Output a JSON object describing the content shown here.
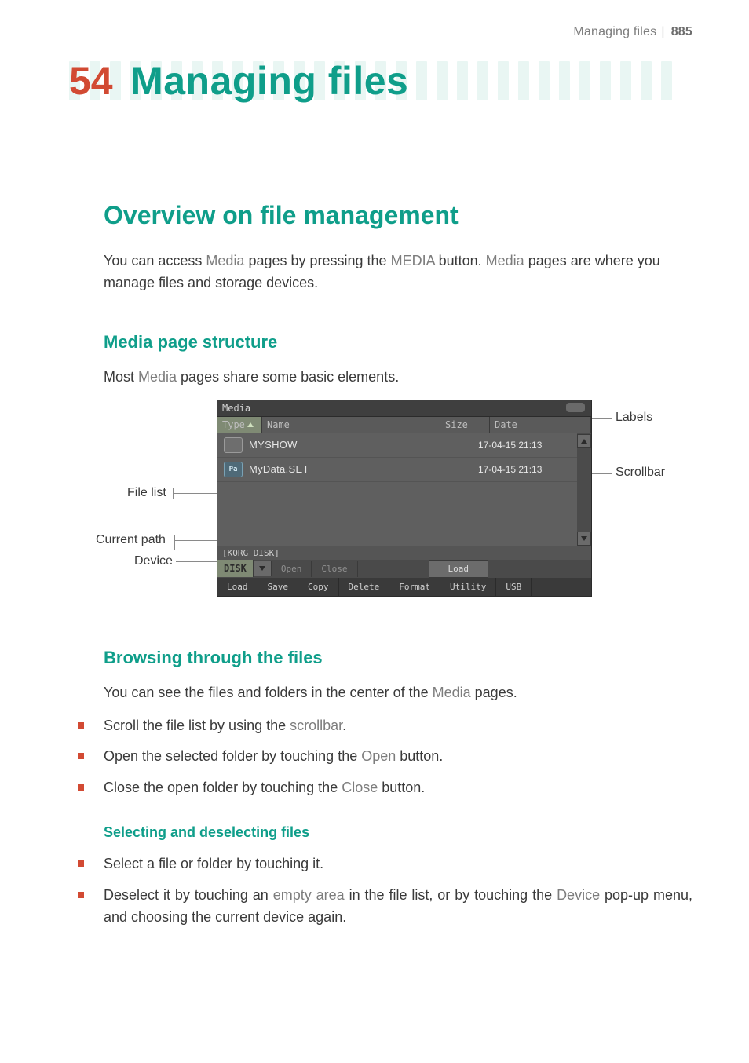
{
  "running_head": {
    "title": "Managing files",
    "page": "885"
  },
  "chapter": {
    "number": "54",
    "title": "Managing files"
  },
  "section": {
    "title": "Overview on file management"
  },
  "intro": {
    "seg1": "You can access ",
    "kw1": "Media",
    "seg2": " pages by pressing the ",
    "kw2": "MEDIA",
    "seg3": " button. ",
    "kw3": "Media",
    "seg4": " pages are where you manage files and storage devices."
  },
  "sub1": {
    "title": "Media page structure"
  },
  "sub1_lead": {
    "seg1": "Most ",
    "kw1": "Media",
    "seg2": " pages share some basic elements."
  },
  "shot": {
    "title": "Media",
    "cols": {
      "type": "Type",
      "name": "Name",
      "size": "Size",
      "date": "Date"
    },
    "rows": [
      {
        "icon": "",
        "name": "MYSHOW",
        "date": "17-04-15 21:13"
      },
      {
        "icon": "Pa",
        "name": "MyData.SET",
        "date": "17-04-15 21:13"
      }
    ],
    "path": "[KORG DISK]",
    "device": "DISK",
    "dbuttons": {
      "open": "Open",
      "close": "Close",
      "load": "Load"
    },
    "tabs": [
      "Load",
      "Save",
      "Copy",
      "Delete",
      "Format",
      "Utility",
      "USB"
    ]
  },
  "callouts": {
    "labels": "Labels",
    "scrollbar": "Scrollbar",
    "filelist": "File list",
    "currentpath": "Current path",
    "device": "Device"
  },
  "sub2": {
    "title": "Browsing through the files"
  },
  "sub2_lead": {
    "seg1": "You can see the files and folders in the center of the ",
    "kw1": "Media",
    "seg2": " pages."
  },
  "bullets_a": {
    "b1": {
      "seg1": "Scroll the file list by using the ",
      "kw1": "scrollbar",
      "seg2": "."
    },
    "b2": {
      "seg1": "Open the selected folder by touching the ",
      "kw1": "Open",
      "seg2": " button."
    },
    "b3": {
      "seg1": "Close the open folder by touching the ",
      "kw1": "Close",
      "seg2": " button."
    }
  },
  "minor": {
    "title": "Selecting and deselecting files"
  },
  "bullets_b": {
    "b1": "Select a file or folder by touching it.",
    "b2": {
      "seg1": "Deselect it by touching an ",
      "kw1": "empty area",
      "seg2": " in the file list, or by touching the ",
      "kw2": "Device",
      "seg3": " pop-up menu, and choosing the current device again."
    }
  }
}
